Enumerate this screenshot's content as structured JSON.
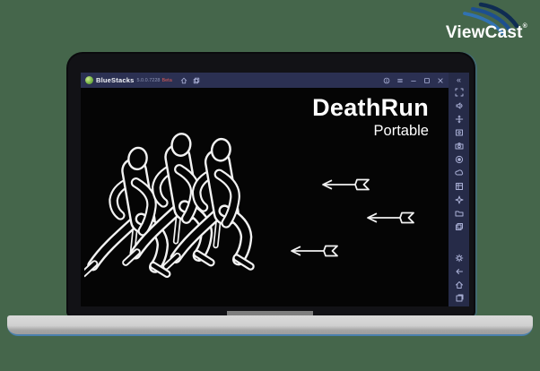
{
  "background_color": "#45664b",
  "logo": {
    "brand": "ViewCast",
    "registered_mark": "®",
    "arc_colors": [
      "#0f2c52",
      "#1d4f8f",
      "#3172b1"
    ],
    "text_color": "#ffffff"
  },
  "bluestacks": {
    "titlebar": {
      "app_name": "BlueStacks",
      "version": "5.0.0.7228",
      "beta_label": "Beta",
      "bar_color": "#2b3052",
      "left_icons": [
        "home",
        "multi-instance"
      ],
      "right_icons": [
        "info",
        "menu",
        "minimize",
        "maximize",
        "close"
      ]
    },
    "sidebar": {
      "collapse_glyph": "«",
      "top_icons": [
        "fullscreen",
        "volume",
        "move",
        "screenshot",
        "camera",
        "record",
        "cloud",
        "macro",
        "shake",
        "folder",
        "multi-window"
      ],
      "bottom_icons": [
        "settings",
        "back",
        "home",
        "recent-apps"
      ]
    },
    "game": {
      "title": "DeathRun",
      "subtitle": "Portable",
      "arrow_count": 3,
      "figure_count": 3,
      "outline_color": "#f2f2f2",
      "screen_color": "#050505"
    }
  }
}
